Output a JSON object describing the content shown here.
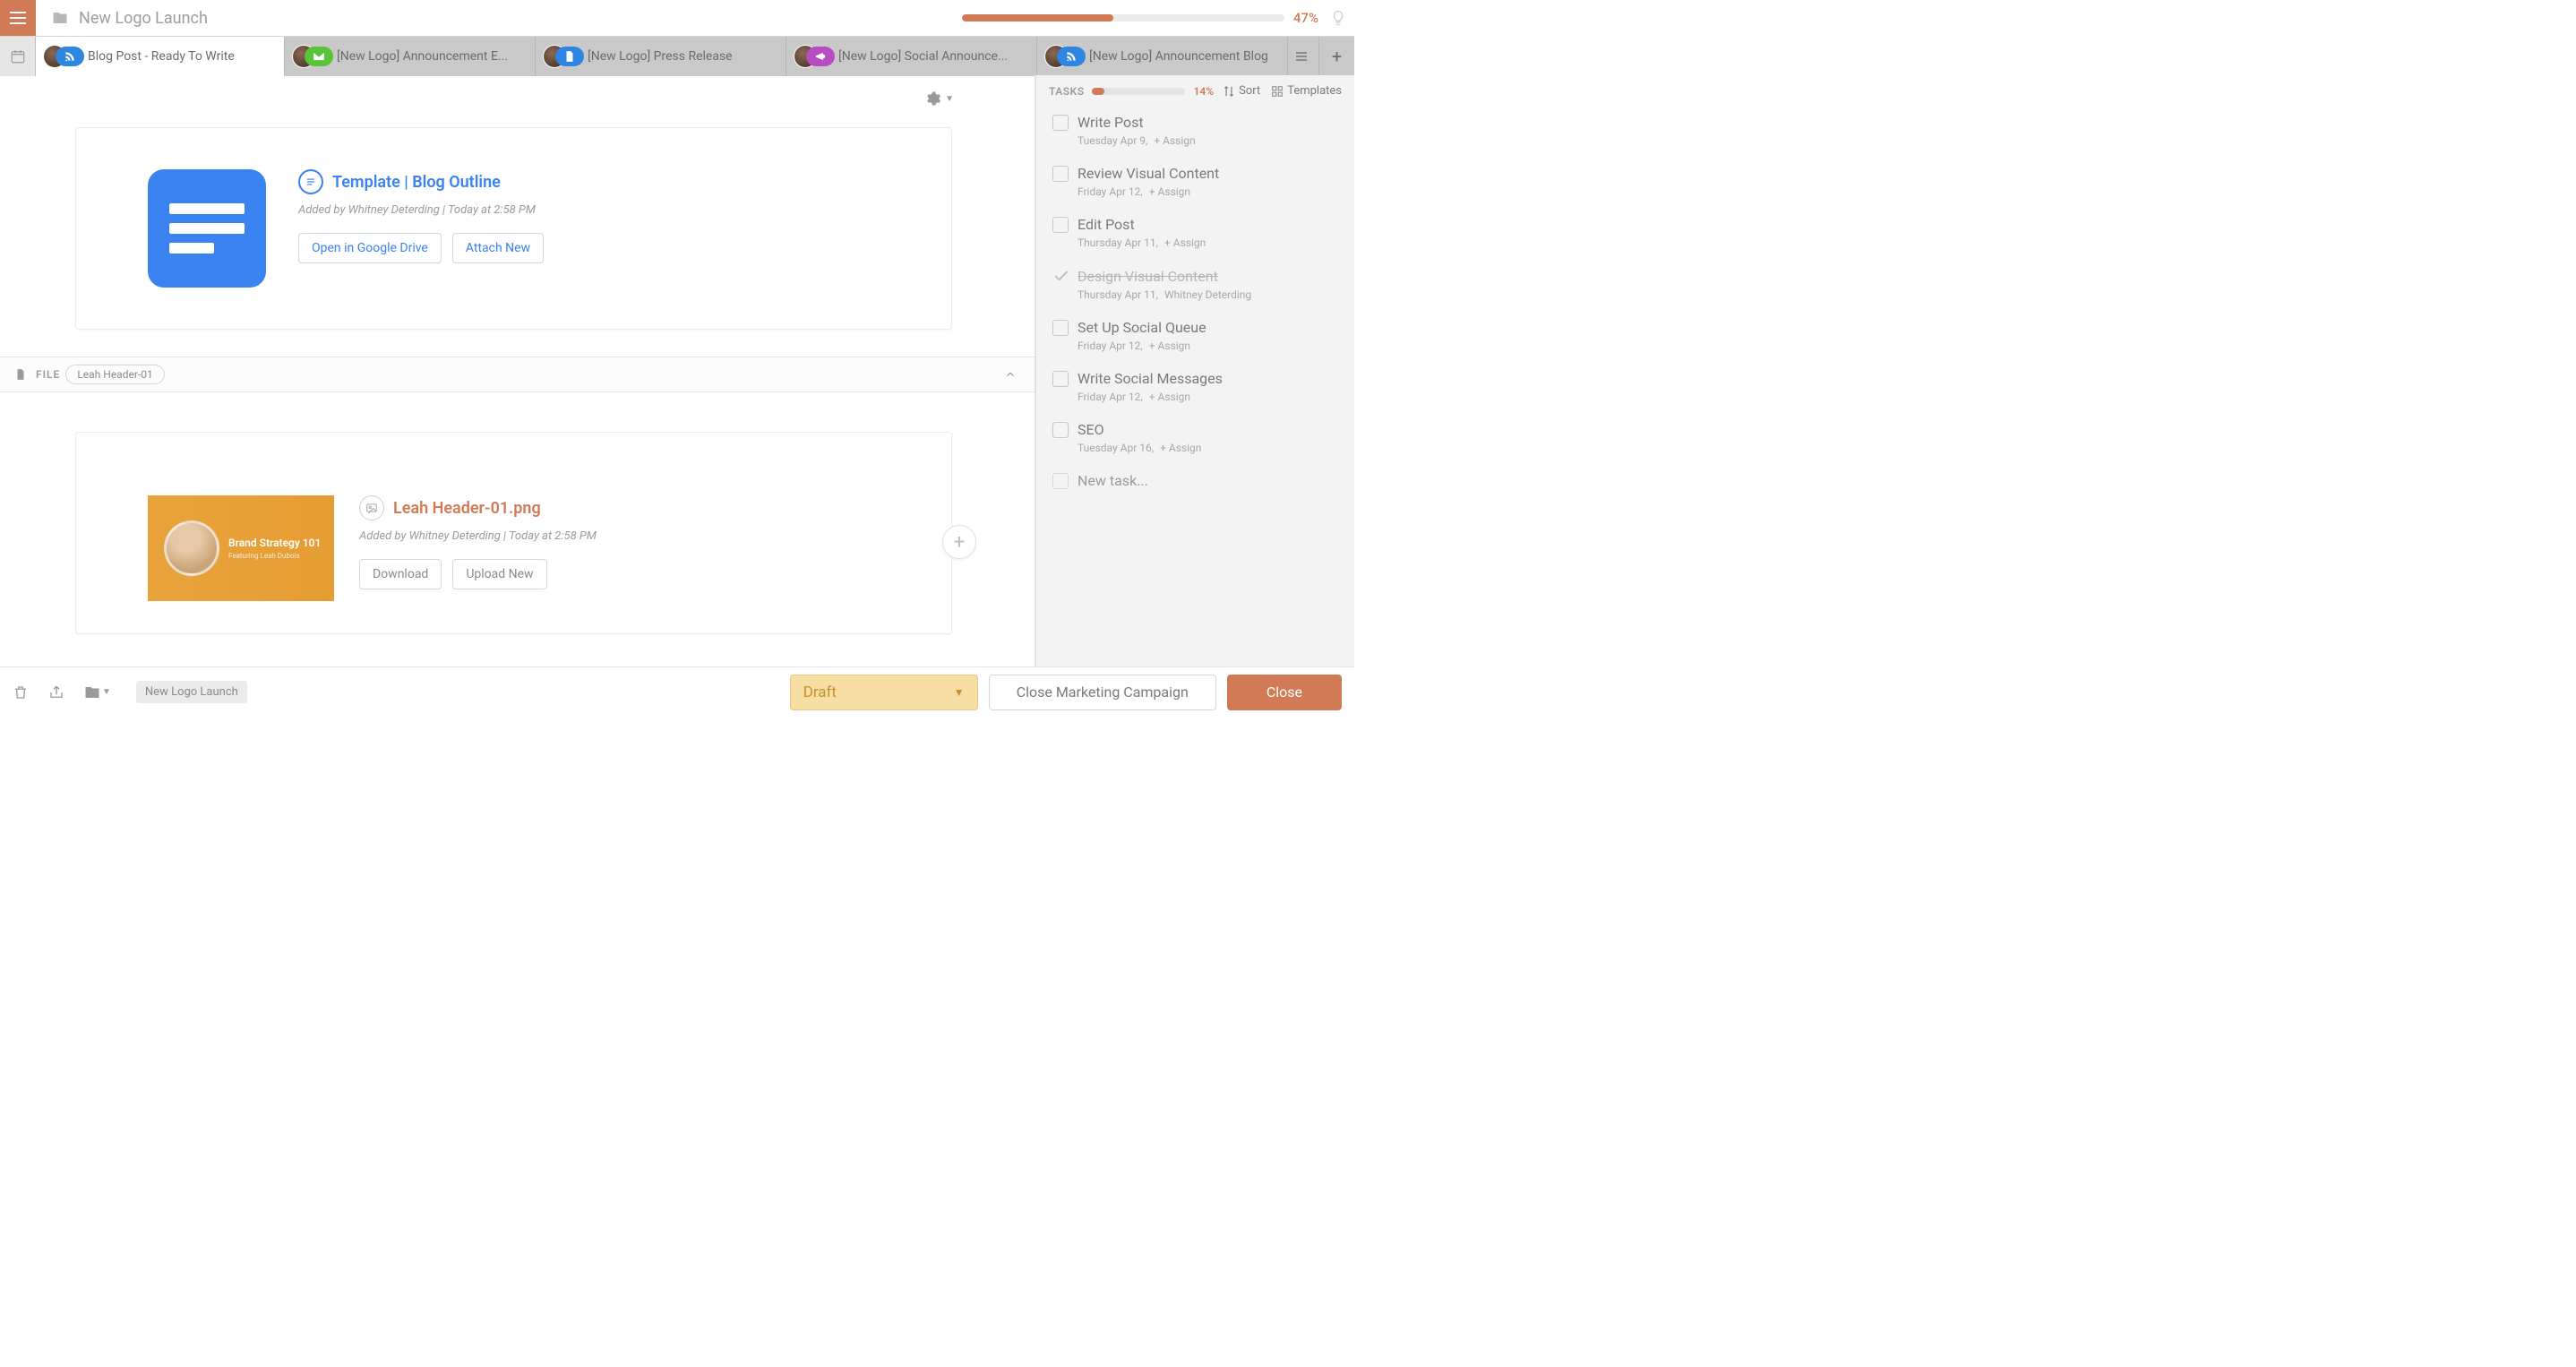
{
  "header": {
    "breadcrumb": "New Logo Launch",
    "progress_pct": 47,
    "progress_text": "47%"
  },
  "tabs": [
    {
      "label": "Blog Post - Ready To Write",
      "pill_class": "pill-rss",
      "icon": "rss",
      "active": true
    },
    {
      "label": "[New Logo] Announcement E...",
      "pill_class": "pill-mail",
      "icon": "mail",
      "active": false
    },
    {
      "label": "[New Logo] Press Release",
      "pill_class": "pill-doc",
      "icon": "doc",
      "active": false
    },
    {
      "label": "[New Logo] Social Announce...",
      "pill_class": "pill-mega",
      "icon": "mega",
      "active": false
    },
    {
      "label": "[New Logo] Announcement Blog",
      "pill_class": "pill-rss",
      "icon": "rss",
      "active": false
    }
  ],
  "attachment1": {
    "title": "Template | Blog Outline",
    "meta": "Added by Whitney Deterding | Today at 2:58 PM",
    "open_label": "Open in Google Drive",
    "attach_label": "Attach New"
  },
  "file_section": {
    "label": "FILE",
    "tag": "Leah Header-01"
  },
  "attachment2": {
    "title": "Leah Header-01.png",
    "meta": "Added by Whitney Deterding | Today at 2:58 PM",
    "download_label": "Download",
    "upload_label": "Upload New",
    "thumb_title": "Brand Strategy 101",
    "thumb_sub": "Featuring Leah Dubois"
  },
  "sidebar": {
    "header_label": "TASKS",
    "progress_pct": 14,
    "progress_text": "14%",
    "sort_label": "Sort",
    "templates_label": "Templates",
    "newtask_label": "New task...",
    "tasks": [
      {
        "title": "Write Post",
        "date": "Tuesday Apr 9,",
        "assign": "+ Assign",
        "done": false
      },
      {
        "title": "Review Visual Content",
        "date": "Friday Apr 12,",
        "assign": "+ Assign",
        "done": false
      },
      {
        "title": "Edit Post",
        "date": "Thursday Apr 11,",
        "assign": "+ Assign",
        "done": false
      },
      {
        "title": "Design Visual Content",
        "date": "Thursday Apr 11,",
        "assign": "Whitney Deterding",
        "done": true
      },
      {
        "title": "Set Up Social Queue",
        "date": "Friday Apr 12,",
        "assign": "+ Assign",
        "done": false
      },
      {
        "title": "Write Social Messages",
        "date": "Friday Apr 12,",
        "assign": "+ Assign",
        "done": false
      },
      {
        "title": "SEO",
        "date": "Tuesday Apr 16,",
        "assign": "+ Assign",
        "done": false
      }
    ]
  },
  "footer": {
    "crumb": "New Logo Launch",
    "status": "Draft",
    "close_campaign": "Close Marketing Campaign",
    "close": "Close"
  }
}
